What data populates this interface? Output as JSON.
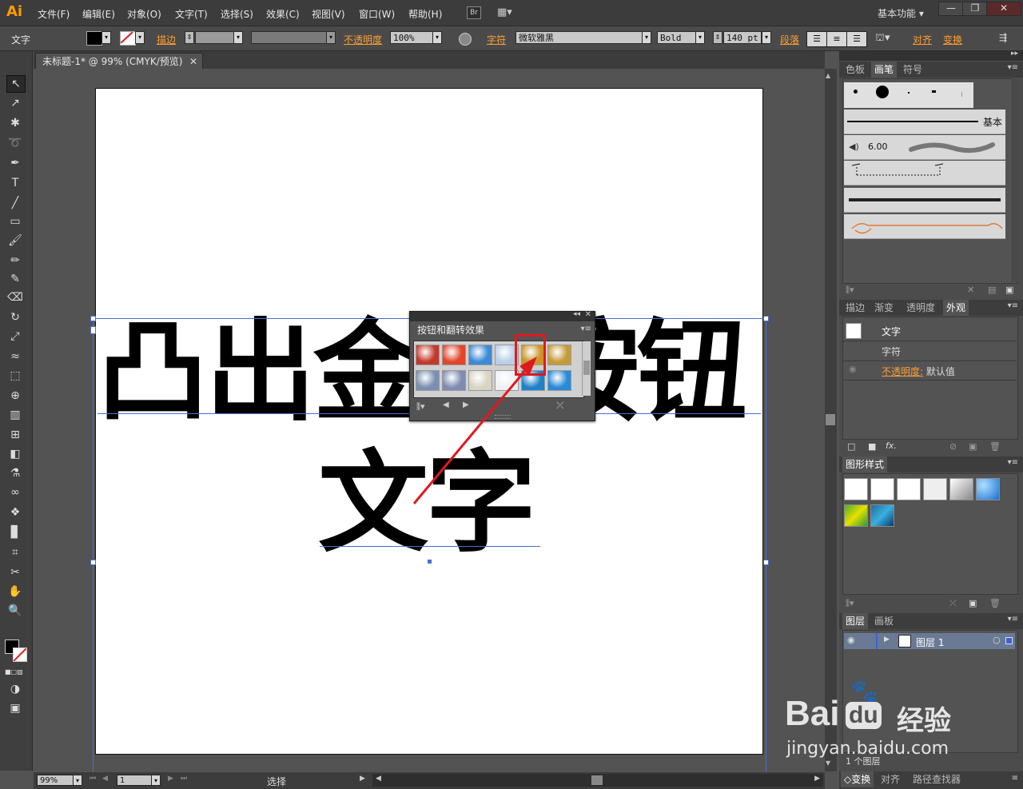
{
  "app": {
    "logo": "Ai",
    "workspace": "基本功能"
  },
  "menu": [
    "文件(F)",
    "编辑(E)",
    "对象(O)",
    "文字(T)",
    "选择(S)",
    "效果(C)",
    "视图(V)",
    "窗口(W)",
    "帮助(H)"
  ],
  "menu_extra": {
    "bridge": "Br"
  },
  "window_controls": {
    "minimize": "—",
    "restore": "❐",
    "close": "✕"
  },
  "control_bar": {
    "type_label": "文字",
    "stroke_label": "描边",
    "opacity_label": "不透明度",
    "opacity_value": "100%",
    "character_label": "字符",
    "font_family": "微软雅黑",
    "font_style": "Bold",
    "font_size": "140 pt",
    "paragraph_label": "段落",
    "align_label": "对齐",
    "transform_label": "变换"
  },
  "document_tab": {
    "title": "未标题-1* @ 99% (CMYK/预览)",
    "close": "✕"
  },
  "canvas": {
    "line1": "凸出金色按钮",
    "line2": "文字"
  },
  "floating_panel": {
    "title": "按钮和翻转效果",
    "swatch_colors": [
      "#c23a2a",
      "#e2452a",
      "#3d8ad6",
      "#b9cfe8",
      "#c9962a",
      "#c49b3b",
      "#7a8fb0",
      "#7f8db2",
      "#d9d3c4",
      "#eef0f4",
      "#1f82c9",
      "#2a8ad6"
    ]
  },
  "right_panels": {
    "brush_tabs": [
      "色板",
      "画笔",
      "符号"
    ],
    "brush_active": "画笔",
    "brush_basic_label": "基本",
    "brush_size": "6.00",
    "appearance_tabs": [
      "描边",
      "渐变",
      "透明度",
      "外观"
    ],
    "appearance_active": "外观",
    "appearance_title": "文字",
    "appearance_rows": [
      "字符",
      "不透明度:",
      "默认值"
    ],
    "graphic_styles_tab": "图形样式",
    "layers_tabs": [
      "图层",
      "画板"
    ],
    "layer_name": "图层 1",
    "layers_count": "1 个图层",
    "bottom_tabs": [
      "变换",
      "对齐",
      "路径查找器"
    ]
  },
  "status_bar": {
    "zoom": "99%",
    "artboard": "1",
    "tool": "选择"
  },
  "watermark": {
    "brand": "Bai",
    "du": "du",
    "cn": "经验",
    "url": "jingyan.baidu.com"
  },
  "colors": {
    "accent_orange": "#ff9f30",
    "selection_blue": "#4a6fd6",
    "highlight_red": "#e0191f"
  }
}
